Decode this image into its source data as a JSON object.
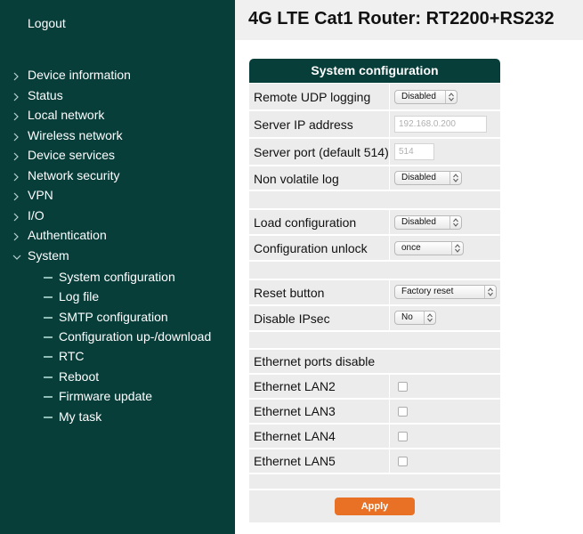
{
  "sidebar": {
    "logout": "Logout",
    "items": [
      {
        "label": "Device information"
      },
      {
        "label": "Status"
      },
      {
        "label": "Local network"
      },
      {
        "label": "Wireless network"
      },
      {
        "label": "Device services"
      },
      {
        "label": "Network security"
      },
      {
        "label": "VPN"
      },
      {
        "label": "I/O"
      },
      {
        "label": "Authentication"
      },
      {
        "label": "System"
      }
    ],
    "subitems": [
      {
        "label": "System configuration"
      },
      {
        "label": "Log file"
      },
      {
        "label": "SMTP configuration"
      },
      {
        "label": "Configuration up-/download"
      },
      {
        "label": "RTC"
      },
      {
        "label": "Reboot"
      },
      {
        "label": "Firmware update"
      },
      {
        "label": "My task"
      }
    ]
  },
  "header": {
    "title": "4G LTE Cat1 Router: RT2200+RS232"
  },
  "config": {
    "title": "System configuration",
    "remote_udp": {
      "label": "Remote UDP logging",
      "value": "Disabled"
    },
    "server_ip": {
      "label": "Server IP address",
      "placeholder": "192.168.0.200"
    },
    "server_port": {
      "label": "Server port (default 514)",
      "placeholder": "514"
    },
    "nonvolatile": {
      "label": "Non volatile log",
      "value": "Disabled"
    },
    "load_config": {
      "label": "Load configuration",
      "value": "Disabled"
    },
    "config_unlock": {
      "label": "Configuration unlock",
      "value": "once"
    },
    "reset_button": {
      "label": "Reset button",
      "value": "Factory reset"
    },
    "disable_ipsec": {
      "label": "Disable IPsec",
      "value": "No"
    },
    "eth_header": "Ethernet ports disable",
    "eth_ports": [
      {
        "label": "Ethernet LAN2",
        "checked": false
      },
      {
        "label": "Ethernet LAN3",
        "checked": false
      },
      {
        "label": "Ethernet LAN4",
        "checked": false
      },
      {
        "label": "Ethernet LAN5",
        "checked": false
      }
    ],
    "apply": "Apply"
  },
  "colors": {
    "sidebar": "#073e3a",
    "accent": "#e87126",
    "panel": "#ececec"
  }
}
